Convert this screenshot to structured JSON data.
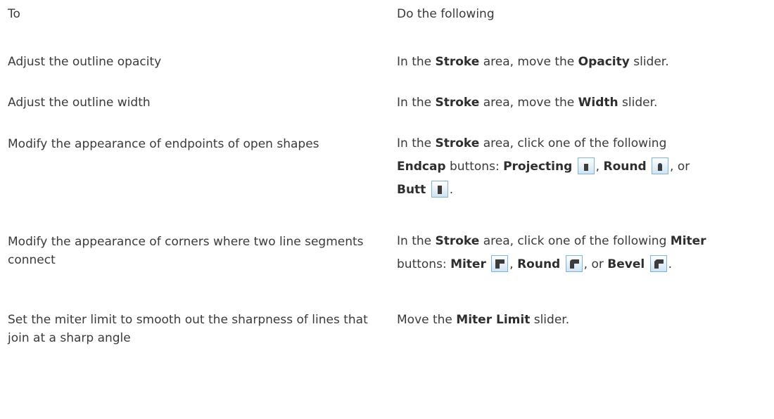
{
  "header": {
    "to": "To",
    "do": "Do the following"
  },
  "rows": [
    {
      "to": "Adjust the outline opacity",
      "do": {
        "pre": "In the ",
        "area": "Stroke",
        "mid": " area, move the ",
        "control": "Opacity",
        "post": " slider."
      }
    },
    {
      "to": "Adjust the outline width",
      "do": {
        "pre": "In the ",
        "area": "Stroke",
        "mid": " area, move the ",
        "control": "Width",
        "post": " slider."
      }
    },
    {
      "to": "Modify the appearance of endpoints of open shapes",
      "do": {
        "pre": "In the ",
        "area": "Stroke",
        "mid": " area, click one of the following ",
        "group": "Endcap",
        "mid2": " buttons: ",
        "b1": "Projecting",
        "sep1": ", ",
        "b2": "Round",
        "sep2": ", or",
        "b3": "Butt",
        "end": "."
      },
      "icons": [
        "endcap-projecting-icon",
        "endcap-round-icon",
        "endcap-butt-icon"
      ]
    },
    {
      "to": "Modify the appearance of corners where two line segments connect",
      "do": {
        "pre": "In the ",
        "area": "Stroke",
        "mid": " area, click one of the following ",
        "group": "Miter",
        "mid2": "buttons: ",
        "b1": "Miter",
        "sep1": ", ",
        "b2": "Round",
        "sep2": ", or ",
        "b3": "Bevel",
        "end": "."
      },
      "icons": [
        "miter-join-icon",
        "round-join-icon",
        "bevel-join-icon"
      ]
    },
    {
      "to": "Set the miter limit to smooth out the sharpness of lines that join at a sharp angle",
      "do": {
        "pre": "Move the ",
        "control": "Miter Limit",
        "post": " slider."
      }
    }
  ],
  "colors": {
    "text": "#3a3a3a",
    "icon_border": "#7fb4d9",
    "icon_fill_top": "#ffffff",
    "icon_fill_bottom": "#cfe3f2",
    "glyph": "#3c3c3c"
  }
}
